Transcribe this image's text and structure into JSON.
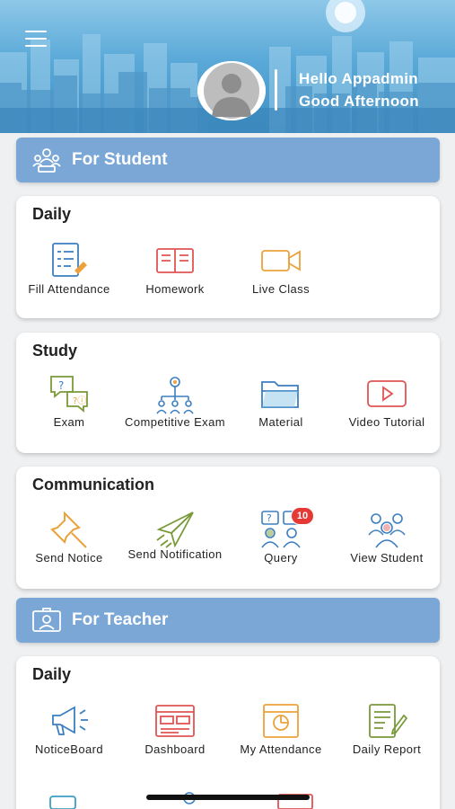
{
  "header": {
    "greeting_line1": "Hello Appadmin",
    "greeting_line2": "Good Afternoon",
    "menu_icon": "hamburger-menu-icon",
    "avatar_icon": "user-avatar-placeholder"
  },
  "student_section": {
    "title": "For Student",
    "icon": "students-group-icon",
    "daily": {
      "title": "Daily",
      "items": [
        {
          "label": "Fill Attendance",
          "icon": "attendance-checklist-icon"
        },
        {
          "label": "Homework",
          "icon": "open-book-icon"
        },
        {
          "label": "Live Class",
          "icon": "video-camera-icon"
        }
      ]
    },
    "study": {
      "title": "Study",
      "items": [
        {
          "label": "Exam",
          "icon": "question-bubble-icon"
        },
        {
          "label": "Competitive Exam",
          "icon": "hierarchy-people-icon"
        },
        {
          "label": "Material",
          "icon": "folder-icon"
        },
        {
          "label": "Video Tutorial",
          "icon": "play-button-icon"
        }
      ]
    },
    "communication": {
      "title": "Communication",
      "items": [
        {
          "label": "Send Notice",
          "icon": "pushpin-icon"
        },
        {
          "label": "Send Notification",
          "icon": "paper-plane-icon"
        },
        {
          "label": "Query",
          "icon": "query-people-icon",
          "badge": "10"
        },
        {
          "label": "View Student",
          "icon": "student-group-icon"
        }
      ]
    }
  },
  "teacher_section": {
    "title": "For Teacher",
    "icon": "id-card-icon",
    "daily": {
      "title": "Daily",
      "items": [
        {
          "label": "NoticeBoard",
          "icon": "megaphone-icon"
        },
        {
          "label": "Dashboard",
          "icon": "dashboard-window-icon"
        },
        {
          "label": "My Attendance",
          "icon": "attendance-sheet-icon"
        },
        {
          "label": "Daily Report",
          "icon": "report-pen-icon"
        }
      ]
    }
  },
  "colors": {
    "section_header": "#7aa7d6",
    "icon_blue": "#3c7fc1",
    "icon_red": "#e05454",
    "icon_orange": "#eba23c",
    "icon_green": "#7a9a3a",
    "badge": "#e53935"
  }
}
